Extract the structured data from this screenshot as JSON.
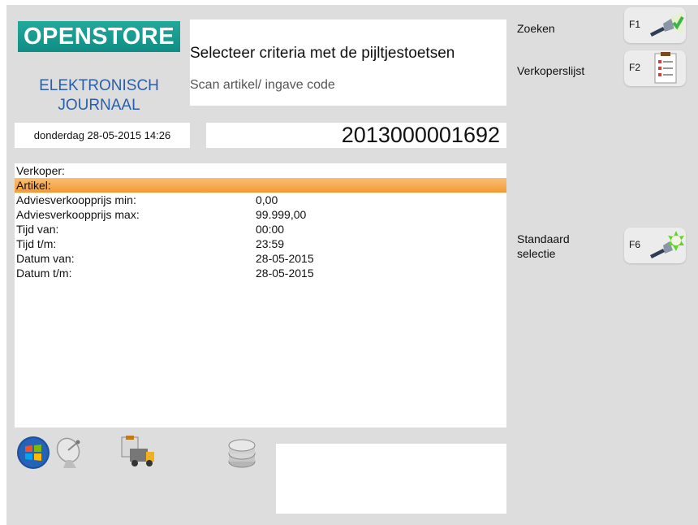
{
  "app": {
    "logo": "OPENSTORE",
    "title_line1": "ELEKTRONISCH",
    "title_line2": "JOURNAAL"
  },
  "message": {
    "line1": "Selecteer criteria met de pijltjestoetsen",
    "line2": "Scan artikel/ ingave code"
  },
  "datetime": "donderdag 28-05-2015 14:26",
  "code": "2013000001692",
  "criteria": [
    {
      "label": "Verkoper:",
      "value": ""
    },
    {
      "label": "Artikel:",
      "value": ""
    },
    {
      "label": "Adviesverkoopprijs min:",
      "value": "0,00"
    },
    {
      "label": "Adviesverkoopprijs max:",
      "value": "99.999,00"
    },
    {
      "label": "Tijd van:",
      "value": "00:00"
    },
    {
      "label": "Tijd t/m:",
      "value": "23:59"
    },
    {
      "label": "Datum van:",
      "value": "28-05-2015"
    },
    {
      "label": "Datum t/m:",
      "value": "28-05-2015"
    }
  ],
  "selected_index": 1,
  "functions": [
    {
      "label": "Zoeken",
      "key": "F1",
      "icon": "flashlight-check-icon"
    },
    {
      "label": "Verkoperslijst",
      "key": "F2",
      "icon": "clipboard-list-icon"
    },
    {
      "label": "Standaard selectie",
      "key": "F6",
      "icon": "flashlight-star-icon"
    }
  ],
  "status_icons": [
    "windows-start-icon",
    "satellite-dish-icon",
    "delivery-truck-icon",
    "database-icon"
  ],
  "colors": {
    "logo": "#1a9d91",
    "title": "#2a5fa8",
    "highlight": "#f5a84a",
    "background": "#dddddd"
  }
}
